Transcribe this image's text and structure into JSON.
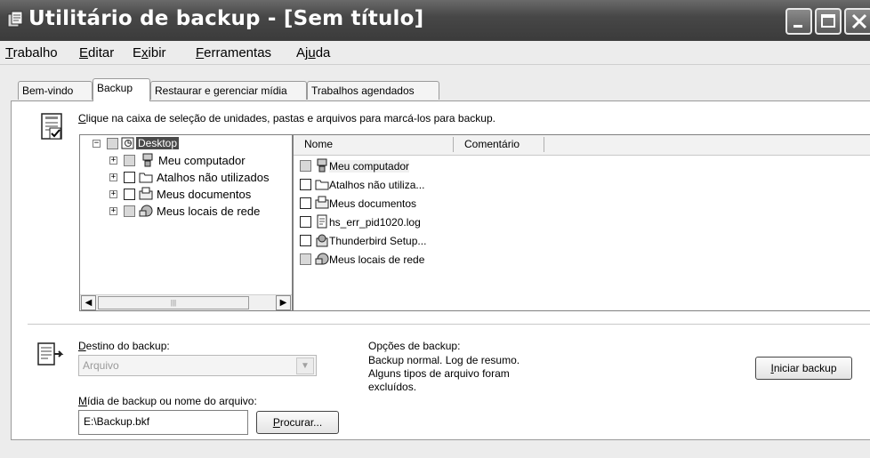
{
  "window": {
    "title": "Utilitário de backup - [Sem título]"
  },
  "menu": [
    {
      "pre": "",
      "key": "T",
      "post": "rabalho"
    },
    {
      "pre": "",
      "key": "E",
      "post": "ditar"
    },
    {
      "pre": "E",
      "key": "x",
      "post": "ibir"
    },
    {
      "pre": "",
      "key": "F",
      "post": "erramentas"
    },
    {
      "pre": "Aj",
      "key": "u",
      "post": "da"
    }
  ],
  "tabs": [
    "Bem-vindo",
    "Backup",
    "Restaurar e gerenciar mídia",
    "Trabalhos agendados"
  ],
  "backup": {
    "instruction_key": "C",
    "instruction_rest": "lique na caixa de seleção de unidades, pastas e arquivos para marcá-los para backup.",
    "tree": [
      {
        "label": "Desktop",
        "expander": "−",
        "check": "grey",
        "icon": "desktop-icon",
        "selected": true
      },
      {
        "label": "Meu computador",
        "expander": "+",
        "check": "grey",
        "icon": "computer-icon"
      },
      {
        "label": "Atalhos não utilizados",
        "expander": "+",
        "check": "empty",
        "icon": "folder-icon"
      },
      {
        "label": "Meus documentos",
        "expander": "+",
        "check": "empty",
        "icon": "documents-icon"
      },
      {
        "label": "Meus locais de rede",
        "expander": "+",
        "check": "grey",
        "icon": "network-icon"
      }
    ],
    "list_headers": [
      "Nome",
      "Comentário"
    ],
    "list_items": [
      {
        "label": "Meu computador",
        "check": "grey",
        "icon": "computer-icon"
      },
      {
        "label": "Atalhos não utiliza...",
        "check": "empty",
        "icon": "folder-icon"
      },
      {
        "label": "Meus documentos",
        "check": "empty",
        "icon": "documents-icon"
      },
      {
        "label": "hs_err_pid1020.log",
        "check": "empty",
        "icon": "text-file-icon"
      },
      {
        "label": "Thunderbird Setup...",
        "check": "empty",
        "icon": "setup-icon"
      },
      {
        "label": "Meus locais de rede",
        "check": "grey",
        "icon": "network-icon"
      }
    ],
    "destination": {
      "label_key": "D",
      "label_rest": "estino do backup:",
      "value": "Arquivo"
    },
    "media": {
      "label_key": "M",
      "label_rest": "ídia de backup ou nome do arquivo:",
      "value": "E:\\Backup.bkf"
    },
    "browse": {
      "key": "P",
      "rest": "rocurar..."
    },
    "options": {
      "title": "Opções de backup:",
      "lines": [
        "Backup normal.  Log de resumo.",
        "Alguns tipos de arquivo foram",
        "excluídos."
      ]
    },
    "start": {
      "key": "I",
      "rest": "niciar backup"
    }
  }
}
